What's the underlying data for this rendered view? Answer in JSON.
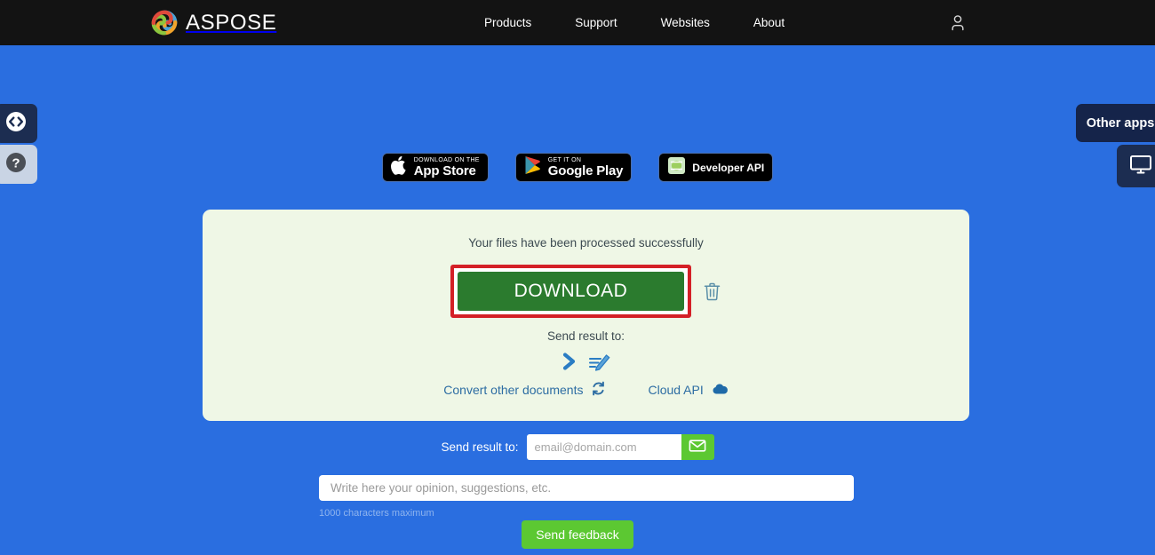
{
  "header": {
    "brand_name": "ASPOSE",
    "brand_logo_icon": "aspose-swirl-logo",
    "nav": [
      {
        "label": "Products"
      },
      {
        "label": "Support"
      },
      {
        "label": "Websites"
      },
      {
        "label": "About"
      }
    ],
    "user_icon": "user-account-icon"
  },
  "side_tabs": {
    "left_code": {
      "icon": "code-brackets-icon",
      "label": ""
    },
    "left_help": {
      "icon": "question-mark-help-icon",
      "label": ""
    },
    "right_apps": {
      "label": "Other apps"
    },
    "right_desktop": {
      "icon": "desktop-monitor-icon",
      "label": ""
    }
  },
  "badges": [
    {
      "name": "app-store",
      "small": "Download on the",
      "big": "App Store",
      "icon": "apple-logo-icon"
    },
    {
      "name": "google-play",
      "small": "GET IT ON",
      "big": "Google Play",
      "icon": "google-play-triangle-icon"
    },
    {
      "name": "developer-api",
      "label": "Developer API",
      "icon": "developer-api-icon"
    }
  ],
  "result_card": {
    "success_message": "Your files have been processed successfully",
    "download_label": "DOWNLOAD",
    "delete_icon": "trash-bin-icon",
    "send_result_label": "Send result to:",
    "send_icons": [
      {
        "name": "chevron-send-icon"
      },
      {
        "name": "signature-pen-icon"
      }
    ],
    "links": [
      {
        "label": "Convert other documents",
        "icon": "refresh-convert-icon"
      },
      {
        "label": "Cloud API",
        "icon": "cloud-icon"
      }
    ]
  },
  "email_form": {
    "label": "Send result to:",
    "placeholder": "email@domain.com",
    "value": "",
    "submit_icon": "envelope-icon"
  },
  "feedback": {
    "placeholder": "Write here your opinion, suggestions, etc.",
    "value": "",
    "char_note": "1000 characters maximum",
    "submit_label": "Send feedback"
  },
  "colors": {
    "page_blue": "#2a6ee0",
    "header_black": "#131313",
    "card_green_tint": "#eff7e6",
    "download_green": "#2b7b2e",
    "annotation_red": "#d42027",
    "accent_green": "#5cc832",
    "link_blue": "#2d6da3",
    "tab_navy": "#1c2d51"
  }
}
